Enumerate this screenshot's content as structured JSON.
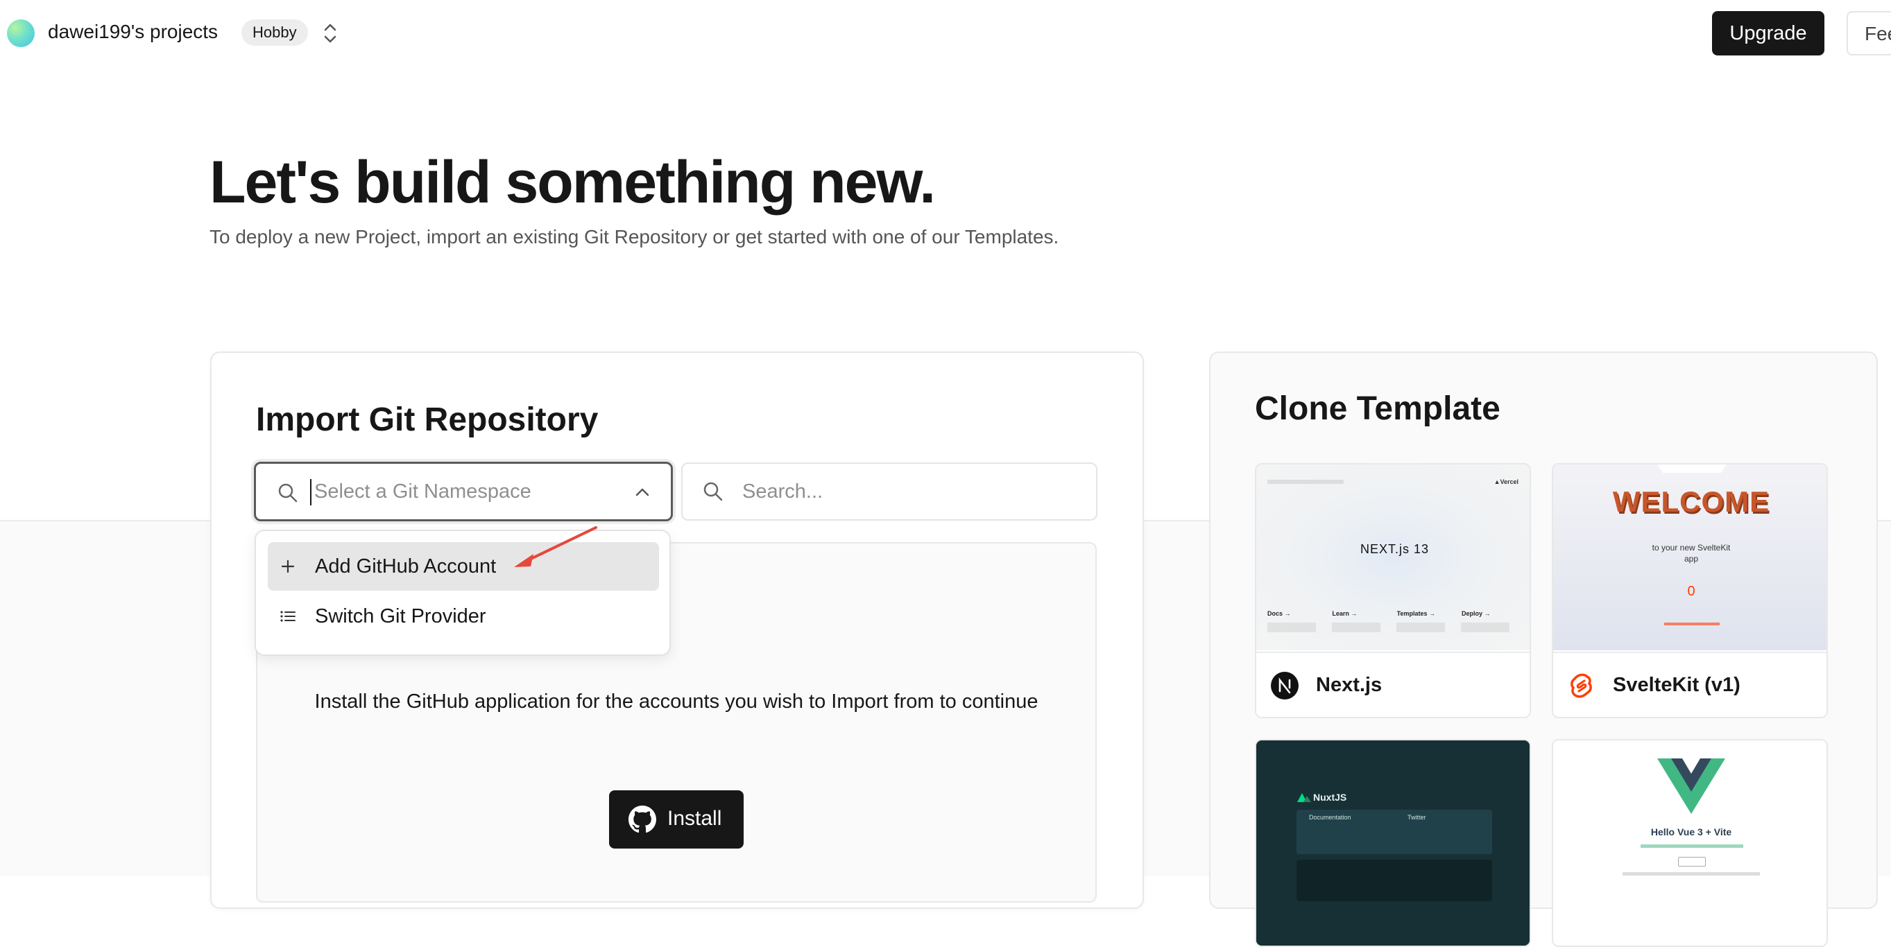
{
  "header": {
    "project_name": "dawei199's projects",
    "plan_badge": "Hobby",
    "upgrade_label": "Upgrade",
    "feedback_label": "Fee"
  },
  "hero": {
    "title": "Let's build something new.",
    "subtitle": "To deploy a new Project, import an existing Git Repository or get started with one of our Templates."
  },
  "import": {
    "title": "Import Git Repository",
    "namespace_placeholder": "Select a Git Namespace",
    "search_placeholder": "Search...",
    "install_text": "Install the GitHub application for the accounts you wish to Import from to continue",
    "install_label": "Install",
    "dropdown": [
      {
        "label": "Add GitHub Account",
        "icon": "plus-icon",
        "active": true
      },
      {
        "label": "Switch Git Provider",
        "icon": "list-icon",
        "active": false
      }
    ]
  },
  "clone": {
    "title": "Clone Template",
    "templates": [
      {
        "name": "Next.js",
        "icon": "nextjs-logo"
      },
      {
        "name": "SvelteKit (v1)",
        "icon": "svelte-logo"
      },
      {
        "name": "NuxtJS",
        "icon": "nuxt-logo"
      },
      {
        "name": "Hello Vue 3 + Vite",
        "icon": "vue-logo"
      }
    ],
    "previews": {
      "next_badge": "NEXT.js 13",
      "next_links": [
        "Docs →",
        "Learn →",
        "Templates →",
        "Deploy →"
      ],
      "svelte_welcome": "WELCOME",
      "svelte_sub": "to your new SvelteKit app",
      "svelte_counter": "0",
      "nuxt_brand": "NuxtJS",
      "nuxt_doc": "Documentation",
      "nuxt_twitter": "Twitter",
      "vue_title": "Hello Vue 3 + Vite"
    }
  },
  "colors": {
    "accent_dark": "#171717",
    "arrow": "#e5483c",
    "svelte": "#ff3e00",
    "vue_green": "#41b883",
    "vue_dark": "#35495e"
  }
}
